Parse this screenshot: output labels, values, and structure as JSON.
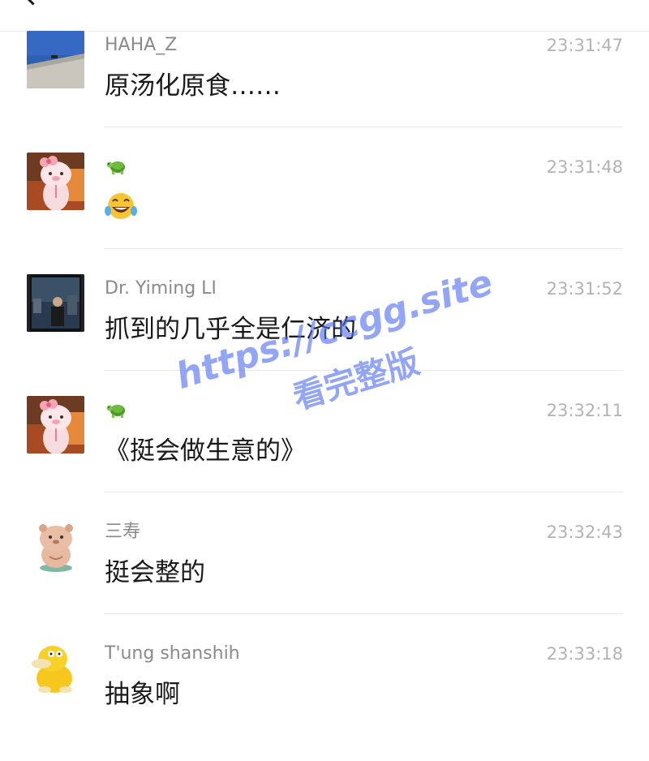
{
  "messages": [
    {
      "sender": "HAHA_Z",
      "time": "23:31:47",
      "content": "原汤化原食……",
      "avatar": "sky-wall-photo"
    },
    {
      "sender": "",
      "sender_icon": "turtle-emoji",
      "time": "23:31:48",
      "content": "",
      "content_icon": "tears-of-joy-emoji",
      "avatar": "pink-pig-mascot"
    },
    {
      "sender": "Dr. Yiming LI",
      "time": "23:31:52",
      "content": "抓到的几乎全是仁济的",
      "avatar": "film-night-photo"
    },
    {
      "sender": "",
      "sender_icon": "turtle-emoji",
      "time": "23:32:11",
      "content": "《挺会做生意的》",
      "avatar": "pink-pig-mascot"
    },
    {
      "sender": "三寿",
      "time": "23:32:43",
      "content": "挺会整的",
      "avatar": "cartoon-bear"
    },
    {
      "sender": "T'ung shanshih",
      "time": "23:33:18",
      "content": "抽象啊",
      "avatar": "psyduck-duck"
    }
  ],
  "watermark": {
    "line1": "https://ccgg.site",
    "line2": "看完整版"
  },
  "icons": {
    "back": "back-chevron-icon"
  }
}
